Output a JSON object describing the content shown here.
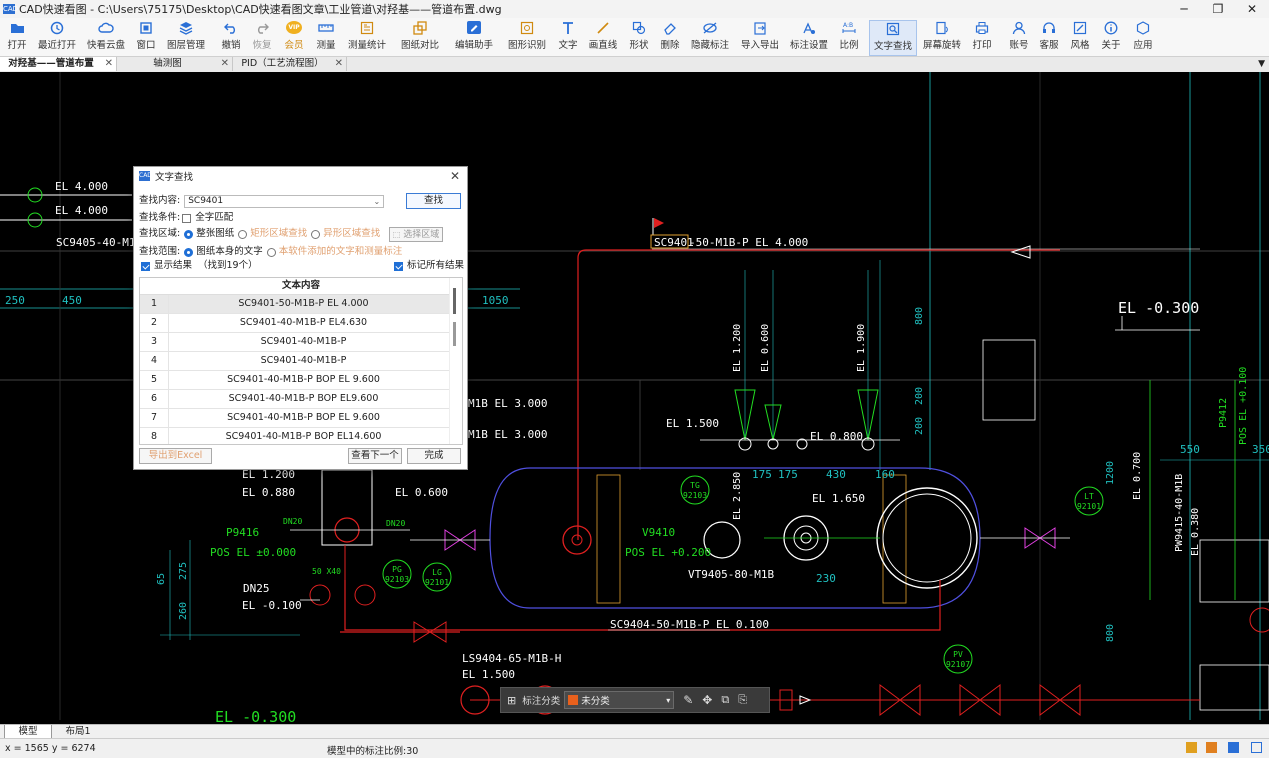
{
  "window": {
    "title": "CAD快速看图 - C:\\Users\\75175\\Desktop\\CAD快速看图文章\\工业管道\\对羟基——管道布置.dwg",
    "app_icon": "CAD"
  },
  "toolbar": [
    {
      "label": "打开",
      "icon": "folder-icon"
    },
    {
      "label": "最近打开",
      "icon": "clock-icon"
    },
    {
      "label": "快看云盘",
      "icon": "cloud-icon"
    },
    {
      "label": "窗口",
      "icon": "window-icon"
    },
    {
      "label": "图层管理",
      "icon": "layers-icon"
    },
    {
      "label": "撤销",
      "icon": "undo-icon"
    },
    {
      "label": "恢复",
      "icon": "redo-icon"
    },
    {
      "label": "会员",
      "icon": "vip-icon",
      "badge": "VIP"
    },
    {
      "label": "测量",
      "icon": "ruler-icon"
    },
    {
      "label": "测量统计",
      "icon": "measure-stats-icon"
    },
    {
      "label": "图纸对比",
      "icon": "compare-icon"
    },
    {
      "label": "编辑助手",
      "icon": "edit-assistant-icon"
    },
    {
      "label": "图形识别",
      "icon": "shape-recognition-icon"
    },
    {
      "label": "文字",
      "icon": "text-icon"
    },
    {
      "label": "画直线",
      "icon": "line-icon"
    },
    {
      "label": "形状",
      "icon": "shape-icon"
    },
    {
      "label": "删除",
      "icon": "eraser-icon"
    },
    {
      "label": "隐藏标注",
      "icon": "hide-annotation-icon"
    },
    {
      "label": "导入导出",
      "icon": "import-export-icon"
    },
    {
      "label": "标注设置",
      "icon": "annotation-settings-icon"
    },
    {
      "label": "比例",
      "icon": "scale-icon"
    },
    {
      "label": "文字查找",
      "icon": "text-search-icon"
    },
    {
      "label": "屏幕旋转",
      "icon": "rotate-screen-icon"
    },
    {
      "label": "打印",
      "icon": "printer-icon"
    },
    {
      "label": "账号",
      "icon": "user-icon"
    },
    {
      "label": "客服",
      "icon": "headset-icon"
    },
    {
      "label": "风格",
      "icon": "style-icon"
    },
    {
      "label": "关于",
      "icon": "info-icon"
    },
    {
      "label": "应用",
      "icon": "apps-icon"
    }
  ],
  "tabs": [
    {
      "label": "对羟基——管道布置"
    },
    {
      "label": "轴测图"
    },
    {
      "label": "PID（工艺流程图）"
    }
  ],
  "dialog": {
    "title": "文字查找",
    "search_label": "查找内容:",
    "search_value": "SC9401",
    "find_button": "查找",
    "condition_label": "查找条件:",
    "whole_word": "全字匹配",
    "area_label": "查找区域:",
    "area_options": [
      "整张图纸",
      "矩形区域查找",
      "异形区域查找"
    ],
    "select_area_button": "选择区域",
    "scope_label": "查找范围:",
    "scope_options": [
      "图纸本身的文字",
      "本软件添加的文字和测量标注"
    ],
    "show_results": "显示结果",
    "found_count": "（找到19个）",
    "mark_all": "标记所有结果",
    "table_header": "文本内容",
    "results": [
      {
        "n": "1",
        "text": "SC9401-50-M1B-P EL 4.000"
      },
      {
        "n": "2",
        "text": "SC9401-40-M1B-P EL4.630"
      },
      {
        "n": "3",
        "text": "SC9401-40-M1B-P"
      },
      {
        "n": "4",
        "text": "SC9401-40-M1B-P"
      },
      {
        "n": "5",
        "text": "SC9401-40-M1B-P BOP EL 9.600"
      },
      {
        "n": "6",
        "text": "SC9401-40-M1B-P BOP EL9.600"
      },
      {
        "n": "7",
        "text": "SC9401-40-M1B-P BOP EL 9.600"
      },
      {
        "n": "8",
        "text": "SC9401-40-M1B-P BOP EL14.600"
      }
    ],
    "export_button": "导出到Excel",
    "next_button": "查看下一个",
    "done_button": "完成"
  },
  "drawing": {
    "labels": {
      "el_4000_a": "EL 4.000",
      "el_4000_b": "EL 4.000",
      "sc9405": "SC9405-40-M1B-",
      "dim_250": "250",
      "dim_450": "450",
      "highlight_main": "SC9401",
      "main_tail": "-50-M1B-P EL 4.000",
      "dim_1050": "1050",
      "el_m0300": "EL -0.300",
      "dim_800": "800",
      "el_1200": "EL 1.200",
      "el_0600v": "EL 0.600",
      "el_1900": "EL 1.900",
      "m1b_3000a": "M1B EL 3.000",
      "m1b_3000b": "M1B EL 3.000",
      "el_1500": "EL 1.500",
      "el_0800": "EL 0.800",
      "dim_200a": "200",
      "dim_200b": "200",
      "p9412": "P9412",
      "pos_0100": "POS EL +0.100",
      "dim_550": "550",
      "dim_350": "350",
      "tg": "TG",
      "tg_no": "92103",
      "dim_175a": "175",
      "dim_175b": "175",
      "dim_430": "430",
      "dim_160": "160",
      "el_1200b": "EL 1.200",
      "el_0880": "EL 0.880",
      "el_0600": "EL 0.600",
      "el_2850": "EL 2.850",
      "el_1650": "EL 1.650",
      "dim_1200": "1200",
      "el_0700": "EL 0.700",
      "pw9415": "PW9415-40-M1B",
      "el_0380": "EL 0.380",
      "lt": "LT",
      "lt_no": "92101",
      "dn20a": "DN20",
      "dn20b": "DN20",
      "p9416": "P9416",
      "pos_0000": "POS EL ±0.000",
      "v9410": "V9410",
      "pos_0200": "POS EL +0.200",
      "vt9405": "VT9405-80-M1B",
      "dim_230": "230",
      "dim_65": "65",
      "dim_275": "275",
      "dim_50x40": "50 X40",
      "dn25": "DN25",
      "el_m0100": "EL -0.100",
      "pg": "PG",
      "pg_no": "92103",
      "lg": "LG",
      "lg_no": "92101",
      "dim_260": "260",
      "sc9404": "SC9404-50-M1B-P EL 0.100",
      "ls9404": "LS9404-65-M1B-H",
      "el_1500b": "EL 1.500",
      "pv": "PV",
      "pv_no": "92107",
      "el_m0300b": "EL -0.300",
      "dim_800b": "800"
    }
  },
  "annotation_bar": {
    "label": "标注分类",
    "category": "未分类",
    "swatch_color": "#e8601c"
  },
  "layout_tabs": [
    {
      "label": "模型"
    },
    {
      "label": "布局1"
    }
  ],
  "status": {
    "coords": "x = 1565  y = 6274",
    "scale_text": "模型中的标注比例:30"
  },
  "colors": {
    "canvas_bg": "#000000",
    "pipe_white": "#ffffff",
    "pipe_red": "#e02020",
    "pipe_green": "#22dd22",
    "equipment_blue": "#5050e0",
    "dimension_cyan": "#20c0c0",
    "accent": "#1f6fd6"
  }
}
